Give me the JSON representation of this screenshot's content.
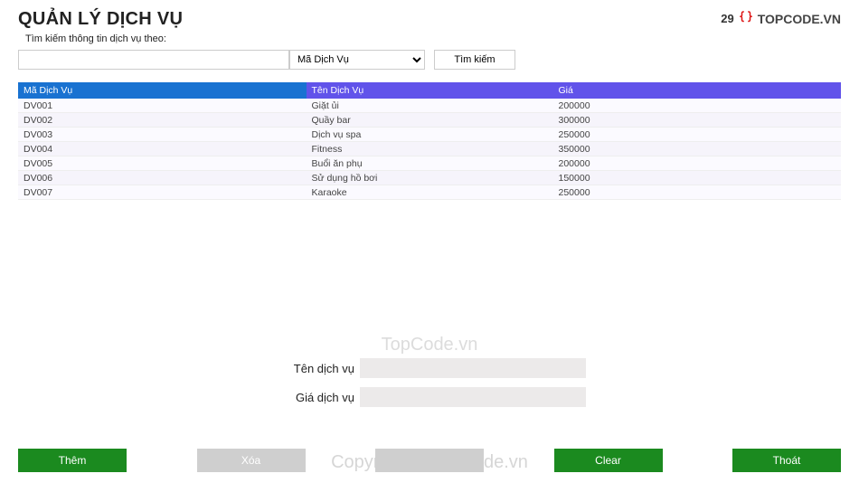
{
  "header": {
    "title": "QUẢN LÝ DỊCH VỤ",
    "brand_left": "29",
    "brand_right": "TOPCODE.VN"
  },
  "search": {
    "label": "Tìm kiếm thông tin dịch vụ theo:",
    "input_value": "",
    "select_value": "Mã Dịch Vụ",
    "button_label": "Tìm kiếm"
  },
  "table": {
    "headers": [
      "Mã Dịch Vụ",
      "Tên Dịch Vụ",
      "Giá"
    ],
    "rows": [
      {
        "id": "DV001",
        "name": "Giặt ủi",
        "price": "200000"
      },
      {
        "id": "DV002",
        "name": "Quầy bar",
        "price": "300000"
      },
      {
        "id": "DV003",
        "name": "Dịch vụ spa",
        "price": "250000"
      },
      {
        "id": "DV004",
        "name": "Fitness",
        "price": "350000"
      },
      {
        "id": "DV005",
        "name": "Buổi ăn phụ",
        "price": "200000"
      },
      {
        "id": "DV006",
        "name": "Sử dụng hồ bơi",
        "price": "150000"
      },
      {
        "id": "DV007",
        "name": "Karaoke",
        "price": "250000"
      }
    ]
  },
  "watermarks": {
    "center1": "TopCode.vn",
    "center2": "Copyright © TopCode.vn"
  },
  "form": {
    "name_label": "Tên dịch vụ",
    "name_value": "",
    "price_label": "Giá dịch vụ",
    "price_value": ""
  },
  "buttons": {
    "add": "Thêm",
    "delete": "Xóa",
    "unnamed": "",
    "clear": "Clear",
    "exit": "Thoát"
  }
}
